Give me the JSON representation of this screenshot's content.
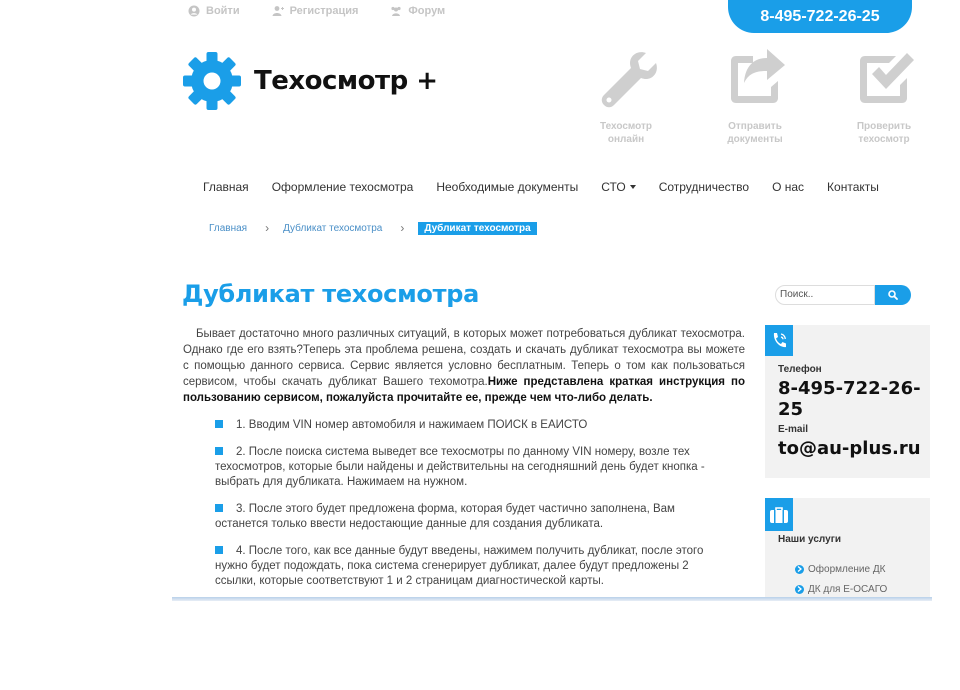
{
  "top_links": {
    "login": "Войти",
    "register": "Регистрация",
    "forum": "Форум"
  },
  "phone_banner": "8-495-722-26-25",
  "logo": {
    "name": "Техосмотр +"
  },
  "features": [
    {
      "label_line1": "Техосмотр",
      "label_line2": "онлайн",
      "icon": "wrench-icon"
    },
    {
      "label_line1": "Отправить",
      "label_line2": "документы",
      "icon": "share-icon"
    },
    {
      "label_line1": "Проверить",
      "label_line2": "техосмотр",
      "icon": "checkbox-icon"
    }
  ],
  "nav": {
    "items": [
      "Главная",
      "Оформление техосмотра",
      "Необходимые документы",
      "СТО",
      "Сотрудничество",
      "О нас",
      "Контакты"
    ]
  },
  "breadcrumb": {
    "home": "Главная",
    "section": "Дубликат техосмотра",
    "current": "Дубликат техосмотра",
    "separator": "›"
  },
  "page": {
    "title": "Дубликат техосмотра",
    "intro_text": "Бывает достаточно много различных ситуаций, в которых может потребоваться дубликат техосмотра. Однако где его взять?Теперь эта проблема решена, создать и скачать дубликат техосмотра вы можете с помощью данного сервиса. Сервис является условно бесплатным. Теперь о том как пользоваться сервисом, чтобы скачать дубликат Вашего техомотра.",
    "intro_bold": "Ниже представлена краткая инструкция по пользованию сервисом, пожалуйста прочитайте ее, прежде чем что-либо делать.",
    "steps": [
      "1. Вводим VIN номер автомобиля и нажимаем ПОИСК в ЕАИСТО",
      "2. После поиска система выведет все техосмотры по данному VIN номеру, возле тех техосмотров, которые были найдены и действительны на сегодняшний день будет кнопка - выбрать для дубликата. Нажимаем на нужном.",
      "3. После этого будет предложена форма, которая будет частично заполнена, Вам останется только ввести недостающие данные для создания дубликата.",
      "4. После того, как все данные будут введены, нажимем получить дубликат, после этого нужно будет подождать, пока система сгенерирует дубликат, далее будут предложены 2 ссылки, которые соответствуют 1 и 2 страницам диагностической карты."
    ]
  },
  "search": {
    "placeholder": "Поиск.."
  },
  "contacts": {
    "phone_label": "Телефон",
    "phone": "8-495-722-26-25",
    "email_label": "E-mail",
    "email": "to@au-plus.ru"
  },
  "services": {
    "title": "Наши услуги",
    "items": [
      "Оформление ДК",
      "ДК для Е-ОСАГО"
    ]
  },
  "colors": {
    "accent": "#1a9ee8",
    "muted": "#c8c8c8"
  }
}
